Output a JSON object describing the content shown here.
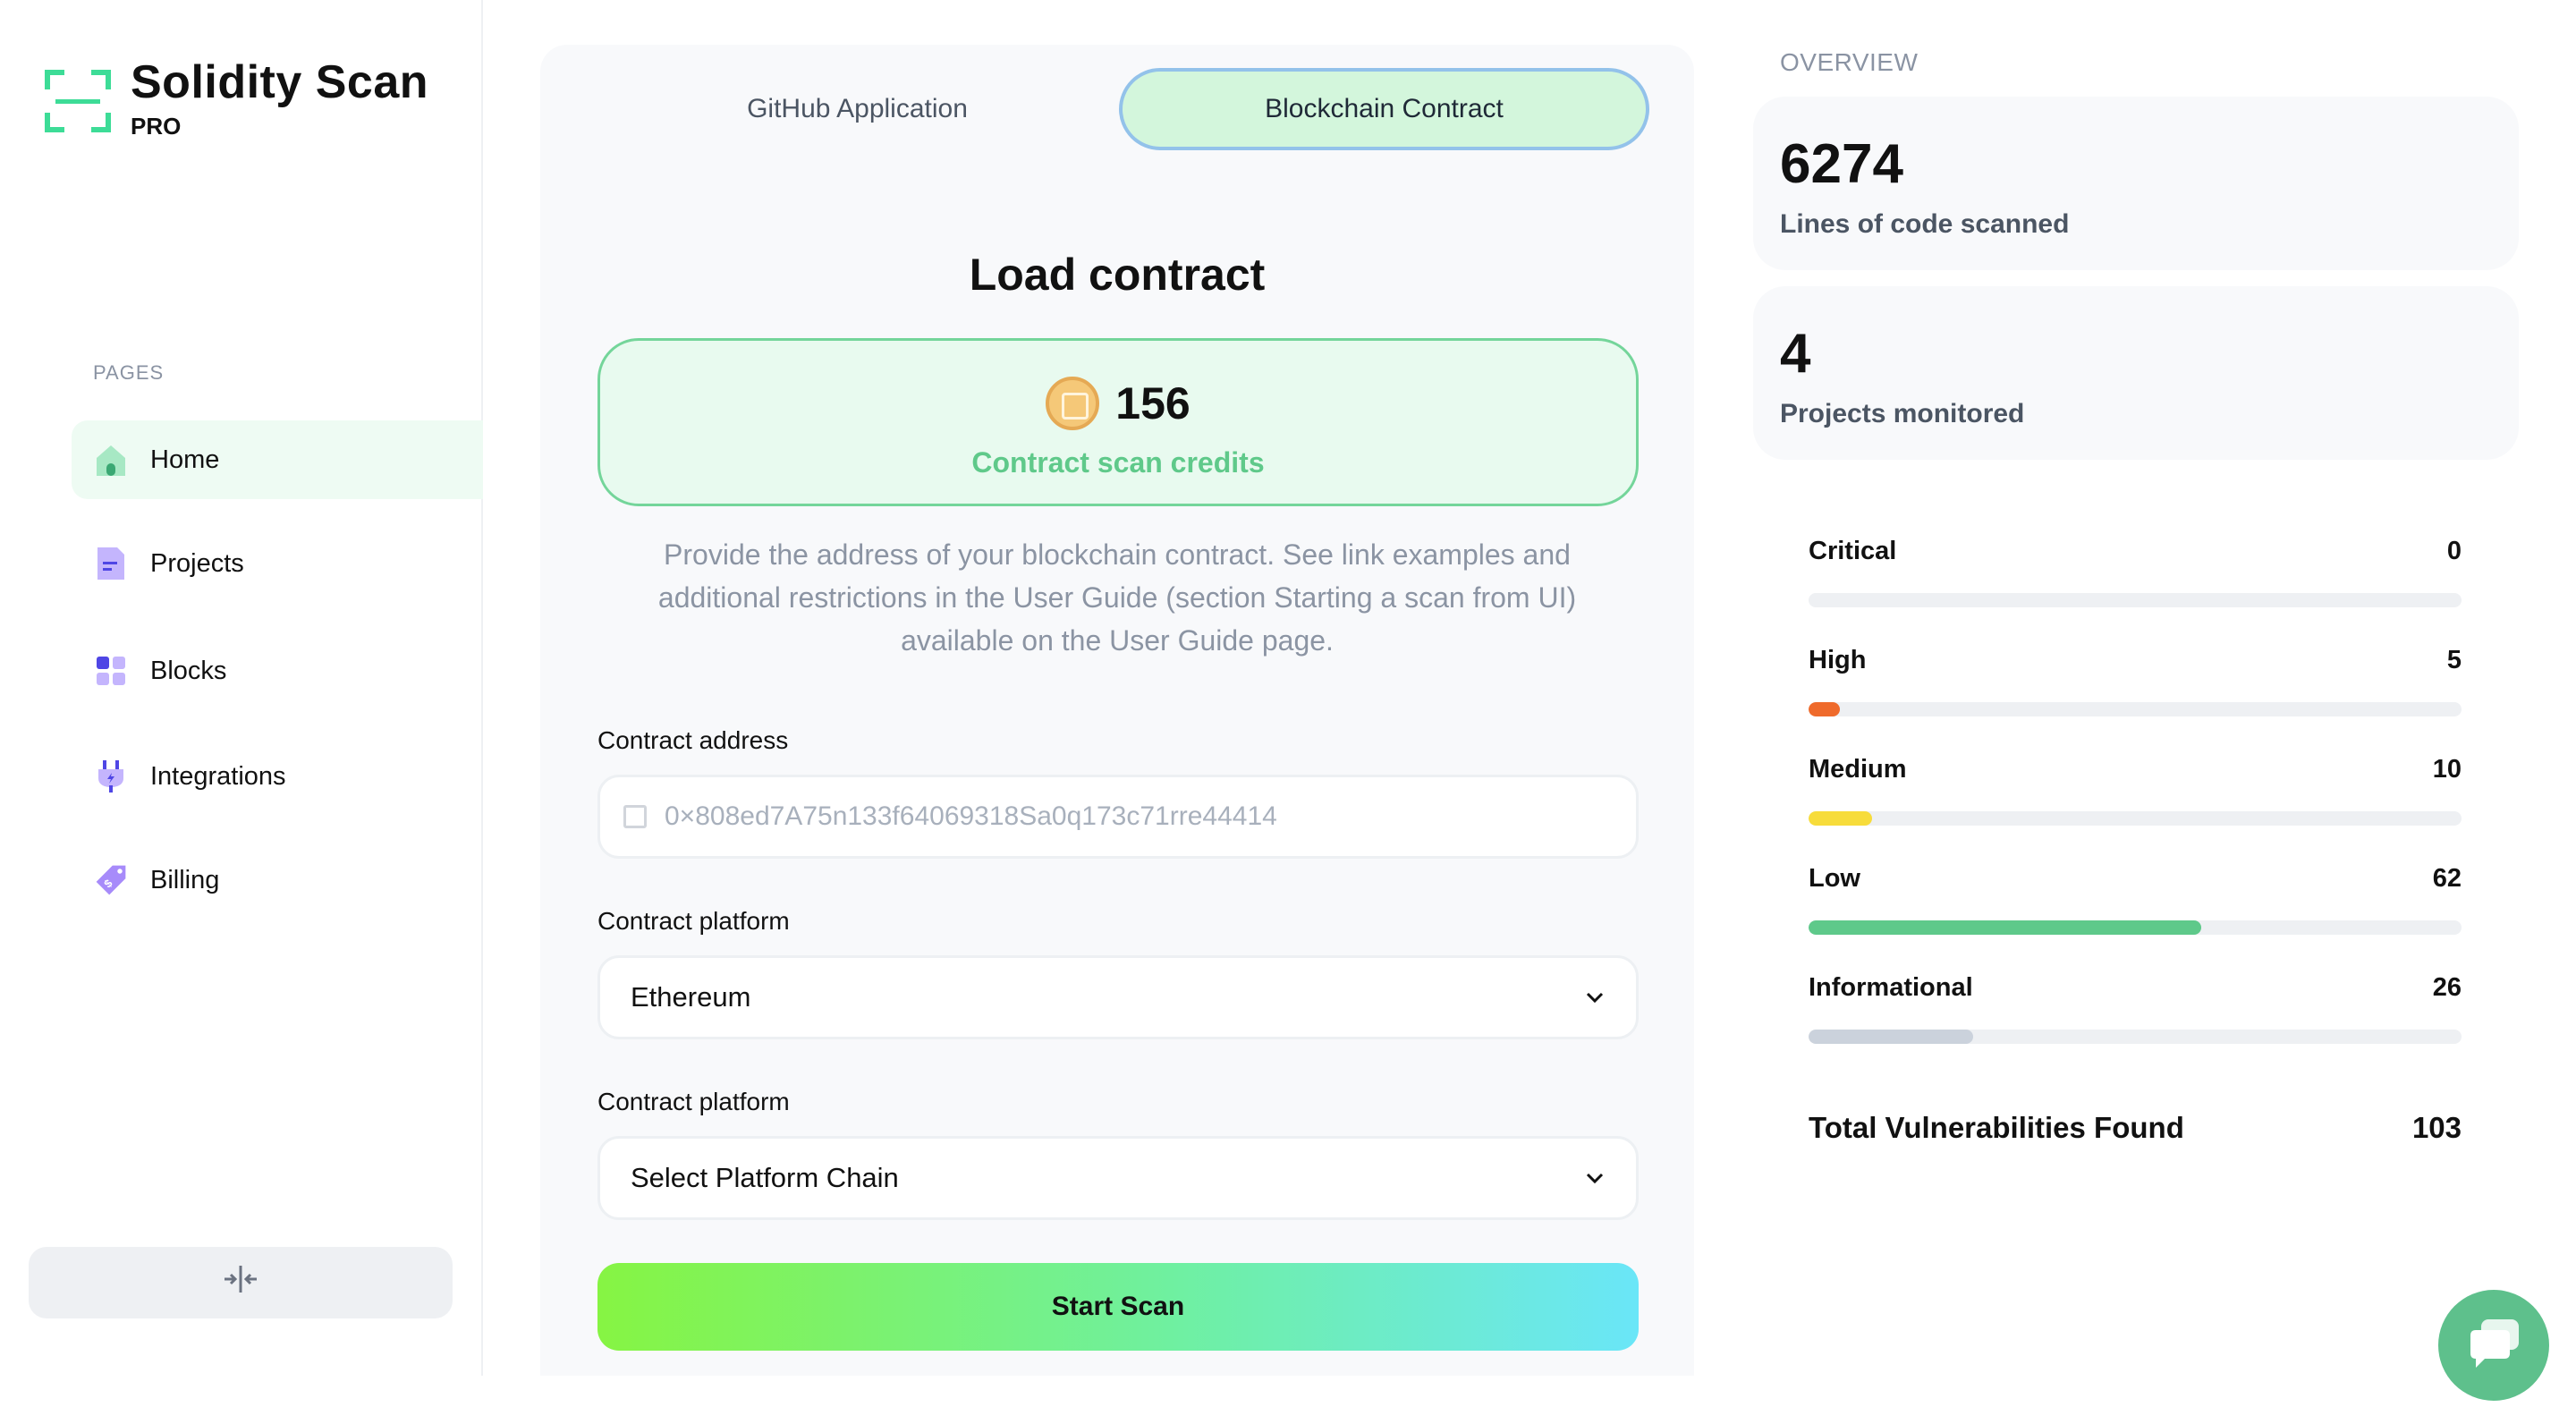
{
  "brand": {
    "title": "Solidity Scan",
    "tier": "PRO"
  },
  "sidebar": {
    "section_label": "PAGES",
    "items": [
      {
        "label": "Home",
        "icon": "home-icon",
        "active": true
      },
      {
        "label": "Projects",
        "icon": "document-icon"
      },
      {
        "label": "Blocks",
        "icon": "blocks-icon"
      },
      {
        "label": "Integrations",
        "icon": "plug-icon"
      },
      {
        "label": "Billing",
        "icon": "price-tag-icon"
      }
    ],
    "collapse_icon": "collapse-icon"
  },
  "tabs": [
    {
      "label": "GitHub Application",
      "active": false
    },
    {
      "label": "Blockchain Contract",
      "active": true
    }
  ],
  "main": {
    "title": "Load contract",
    "credits": {
      "value": "156",
      "label": "Contract scan credits"
    },
    "description": "Provide the address of your blockchain contract. See link examples and additional restrictions in the User Guide (section Starting a scan from UI) available on the User Guide page.",
    "address_label": "Contract address",
    "address_placeholder": "0×808ed7A75n133f64069318Sa0q173c71rre44414",
    "platform_label": "Contract platform",
    "platform_value": "Ethereum",
    "chain_label": "Contract platform",
    "chain_value": "Select Platform Chain",
    "start_label": "Start Scan"
  },
  "overview": {
    "label": "OVERVIEW",
    "cards": [
      {
        "value": "6274",
        "label": "Lines of code scanned"
      },
      {
        "value": "4",
        "label": "Projects monitored"
      }
    ],
    "severities": [
      {
        "name": "Critical",
        "count": "0",
        "fraction": 0.0,
        "color": "#ef4444"
      },
      {
        "name": "High",
        "count": "5",
        "fraction": 0.048,
        "color": "#ef6a2b"
      },
      {
        "name": "Medium",
        "count": "10",
        "fraction": 0.097,
        "color": "#f7dc3b"
      },
      {
        "name": "Low",
        "count": "62",
        "fraction": 0.602,
        "color": "#5ec98a"
      },
      {
        "name": "Informational",
        "count": "26",
        "fraction": 0.252,
        "color": "#cbd2dc"
      }
    ],
    "total_label": "Total Vulnerabilities Found",
    "total_value": "103"
  },
  "chat_icon": "chat-bubble-icon"
}
